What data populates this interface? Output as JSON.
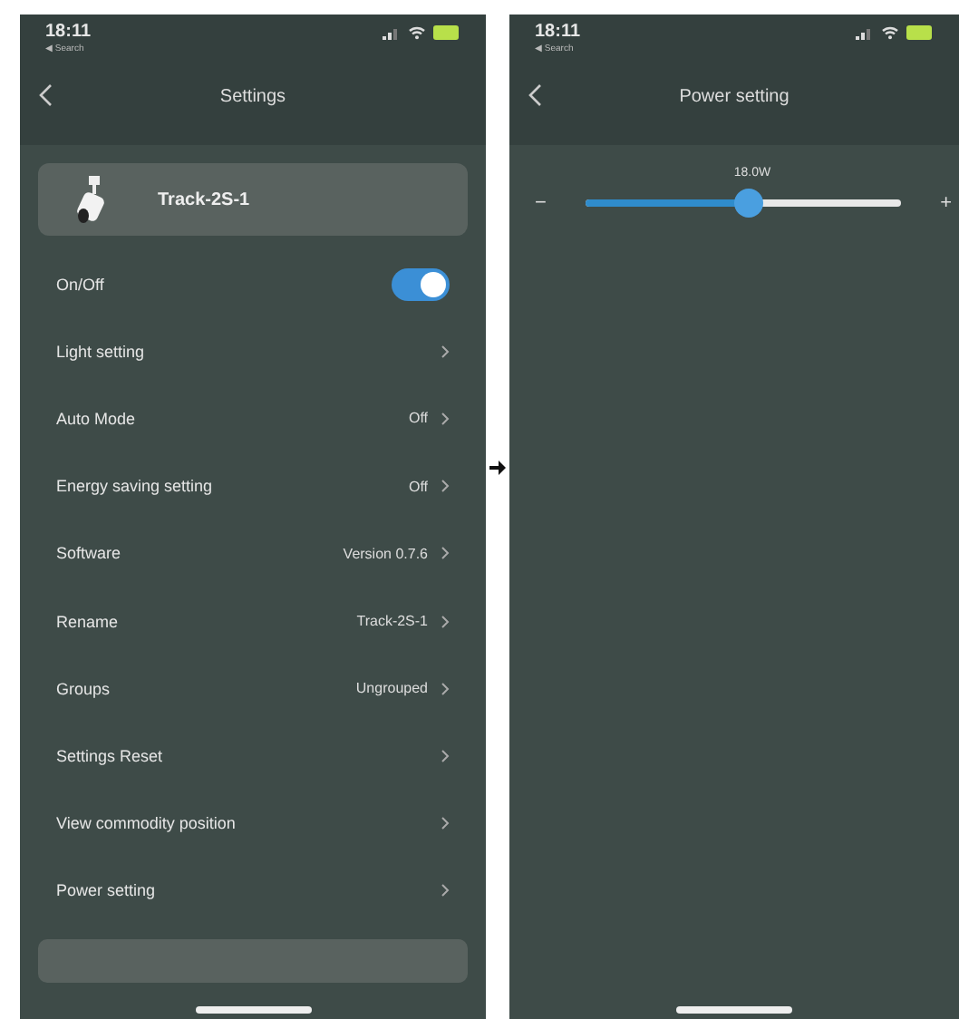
{
  "screens": [
    {
      "status_bar": {
        "time": "18:11",
        "back_app": "◀ Search"
      },
      "title": "Settings",
      "device": {
        "name": "Track-2S-1"
      },
      "rows": [
        {
          "kind": "toggle",
          "label": "On/Off",
          "on": true
        },
        {
          "kind": "link",
          "label": "Light setting"
        },
        {
          "kind": "link",
          "label": "Auto Mode",
          "value": "Off"
        },
        {
          "kind": "link",
          "label": "Energy saving setting",
          "value": "Off"
        },
        {
          "kind": "link",
          "label": "Software",
          "value": "Version 0.7.6"
        },
        {
          "kind": "link",
          "label": "Rename",
          "value": "Track-2S-1"
        },
        {
          "kind": "link",
          "label": "Groups",
          "value": "Ungrouped"
        },
        {
          "kind": "link",
          "label": "Settings Reset"
        },
        {
          "kind": "link",
          "label": "View commodity position"
        },
        {
          "kind": "link",
          "label": "Power setting"
        }
      ]
    },
    {
      "status_bar": {
        "time": "18:11",
        "back_app": "◀ Search"
      },
      "title": "Power setting",
      "power_slider": {
        "reading": "18.0W",
        "minus": "−",
        "plus": "+",
        "level": 0.52
      }
    }
  ]
}
